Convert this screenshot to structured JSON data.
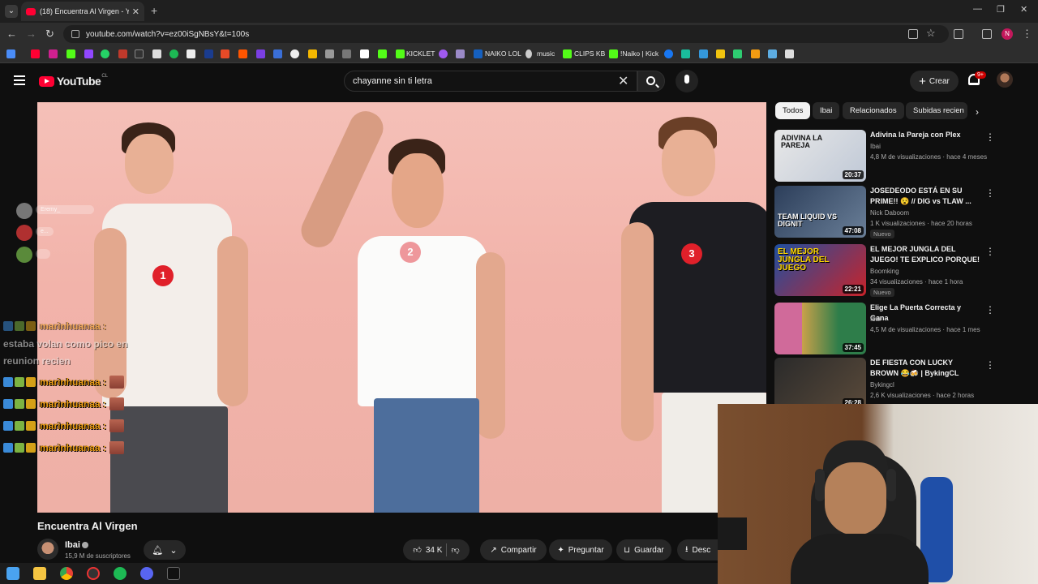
{
  "browser": {
    "tab_title": "(18) Encuentra Al Virgen - Y",
    "url": "youtube.com/watch?v=ez00iSgNBsY&t=100s",
    "profile_initial": "N",
    "bookmarks": [
      "KICKLET",
      "NAIKO LOL",
      "music",
      "CLIPS KB",
      "!Naiko | Kick"
    ]
  },
  "header": {
    "logo_text": "YouTube",
    "country": "CL",
    "search_value": "chayanne sin ti letra",
    "create_label": "Crear",
    "notif_badge": "9+"
  },
  "video": {
    "title": "Encuentra Al Virgen",
    "contestant_numbers": [
      "1",
      "2",
      "3"
    ],
    "channel": "Ibai",
    "subscribers": "15,9 M de suscriptores",
    "likes": "34 K",
    "share_label": "Compartir",
    "ask_label": "Preguntar",
    "save_label": "Guardar",
    "download_label": "Desc"
  },
  "chat_overlay": {
    "top_user": "Eremy_",
    "top_user_tail": "e...",
    "message_user": "marinhuanaa :",
    "message_text_line1": "estaba volan como pico en",
    "message_text_line2": "reunion recien",
    "repeat_user": "marinhuanaa :"
  },
  "chips": [
    "Todos",
    "Ibai",
    "Relacionados",
    "Subidas recien"
  ],
  "recommendations": [
    {
      "title": "Adivina la Pareja con Plex",
      "channel": "Ibai",
      "meta": "4,8 M de visualizaciones · hace 4 meses",
      "duration": "20:37",
      "thumb_text": "ADIVINA LA PAREJA",
      "new": ""
    },
    {
      "title": "JOSEDEODO ESTÁ EN SU PRIME!! 😵 // DIG vs TLAW ...",
      "channel": "Nick Daboom",
      "meta": "1 K visualizaciones · hace 20 horas",
      "duration": "47:08",
      "thumb_text": "TEAM LIQUID VS DIGNIT",
      "new": "Nuevo"
    },
    {
      "title": "EL MEJOR JUNGLA DEL JUEGO! TE EXPLICO PORQUE! - ...",
      "channel": "Boomking",
      "meta": "34 visualizaciones · hace 1 hora",
      "duration": "22:21",
      "thumb_text": "EL MEJOR JUNGLA DEL JUEGO",
      "new": "Nuevo"
    },
    {
      "title": "Elige La Puerta Correcta y Gana",
      "channel": "Ibai",
      "meta": "4,5 M de visualizaciones · hace 1 mes",
      "duration": "37:45",
      "thumb_text": "",
      "new": ""
    },
    {
      "title": "DE FIESTA CON LUCKY BROWN 😂🍻 | BykingCL",
      "channel": "Bykingcl",
      "meta": "2,6 K visualizaciones · hace 2 horas",
      "duration": "26:28",
      "thumb_text": "",
      "new": ""
    }
  ],
  "colors": {
    "yt_red": "#ff0033",
    "background": "#0f0f0f",
    "chip_active": "#f1f1f1",
    "chat_username": "#f0a018"
  }
}
